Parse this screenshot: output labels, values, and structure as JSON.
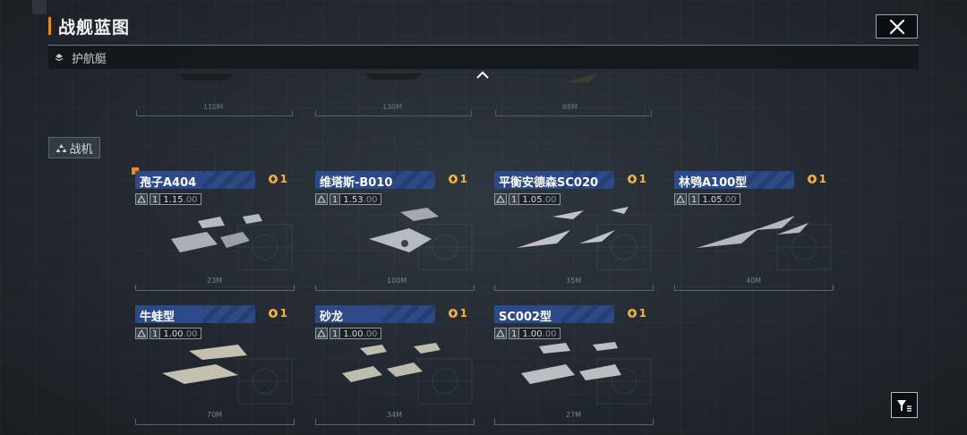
{
  "header": {
    "title": "战舰蓝图",
    "accent_color": "#e68a1e",
    "close_icon": "close-icon"
  },
  "section": {
    "label": "护航艇",
    "icon": "layers-icon",
    "collapse_icon": "chevron-up-icon"
  },
  "partial_cards": [
    {
      "length": "110M"
    },
    {
      "length": "130M"
    },
    {
      "length": "98M"
    }
  ],
  "category": {
    "label": "战机",
    "icon": "fighter-icon"
  },
  "cards": [
    {
      "name": "孢子A404",
      "count": "1",
      "level": "1",
      "value": "1.15",
      "value_suffix": ".00",
      "length": "23M",
      "class_icon": "carrier-icon"
    },
    {
      "name": "维塔斯-B010",
      "count": "1",
      "level": "1",
      "value": "1.53",
      "value_suffix": ".00",
      "length": "100M",
      "class_icon": "ship-icon"
    },
    {
      "name": "平衡安德森SC020",
      "count": "1",
      "level": "1",
      "value": "1.05",
      "value_suffix": ".00",
      "length": "35M",
      "class_icon": "ship-icon"
    },
    {
      "name": "林鸮A100型",
      "count": "1",
      "level": "1",
      "value": "1.05",
      "value_suffix": ".00",
      "length": "40M",
      "class_icon": "speed-icon"
    },
    {
      "name": "牛蛙型",
      "count": "1",
      "level": "1",
      "value": "1.00",
      "value_suffix": ".00",
      "length": "70M",
      "class_icon": "speed-icon"
    },
    {
      "name": "砂龙",
      "count": "1",
      "level": "1",
      "value": "1.00",
      "value_suffix": ".00",
      "length": "34M",
      "class_icon": "speed-icon"
    },
    {
      "name": "SC002型",
      "count": "1",
      "level": "1",
      "value": "1.00",
      "value_suffix": ".00",
      "length": "27M",
      "class_icon": "grid-icon"
    }
  ],
  "filter": {
    "icon": "filter-icon"
  }
}
